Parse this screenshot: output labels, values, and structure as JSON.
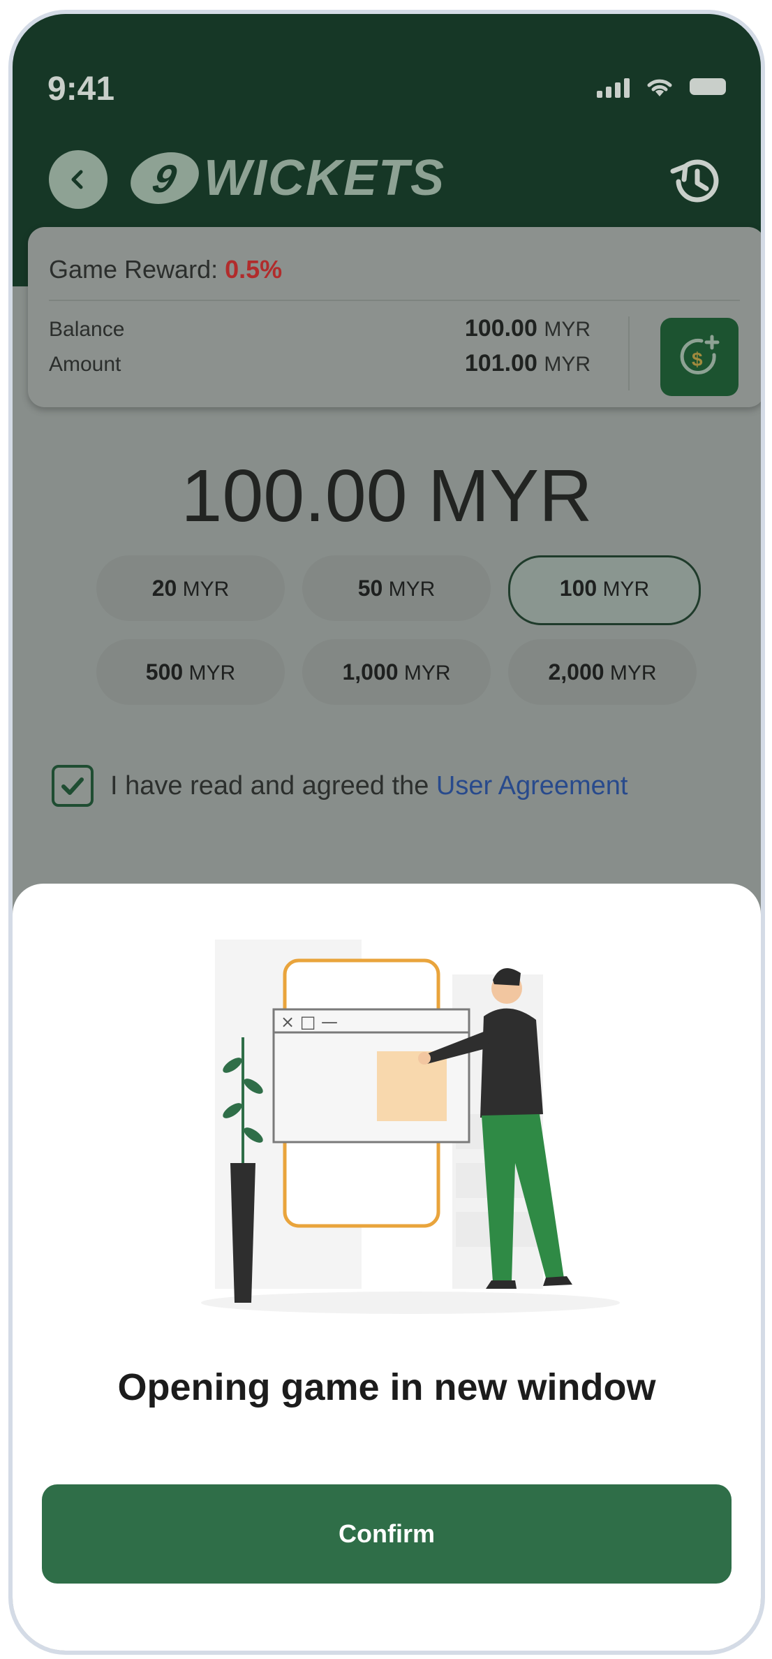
{
  "status_bar": {
    "time": "9:41"
  },
  "header": {
    "logo_mark": "9",
    "logo_text": "WICKETS",
    "back_icon": "chevron-left-icon",
    "history_icon": "history-icon"
  },
  "reward_card": {
    "title_prefix": "Game Reward: ",
    "reward_pct": "0.5%",
    "balance_label": "Balance",
    "balance_value": "100.00",
    "balance_currency": "MYR",
    "amount_label": "Amount",
    "amount_value": "101.00",
    "amount_currency": "MYR",
    "deposit_icon": "dollar-plus-icon"
  },
  "selected_amount": "100.00 MYR",
  "chips": [
    {
      "value": "20",
      "currency": "MYR",
      "selected": false
    },
    {
      "value": "50",
      "currency": "MYR",
      "selected": false
    },
    {
      "value": "100",
      "currency": "MYR",
      "selected": true
    },
    {
      "value": "500",
      "currency": "MYR",
      "selected": false
    },
    {
      "value": "1,000",
      "currency": "MYR",
      "selected": false
    },
    {
      "value": "2,000",
      "currency": "MYR",
      "selected": false
    }
  ],
  "agreement": {
    "checked": true,
    "text": "I have read and agreed the ",
    "link": "User Agreement"
  },
  "sheet": {
    "title": "Opening game in new window",
    "confirm_label": "Confirm",
    "window_controls": "× □ —"
  },
  "colors": {
    "header_bg": "#163726",
    "accent_green": "#2f6e48",
    "reward_red": "#b12c2c",
    "link_blue": "#284a8c",
    "overlay_gray": "#888e8b"
  }
}
